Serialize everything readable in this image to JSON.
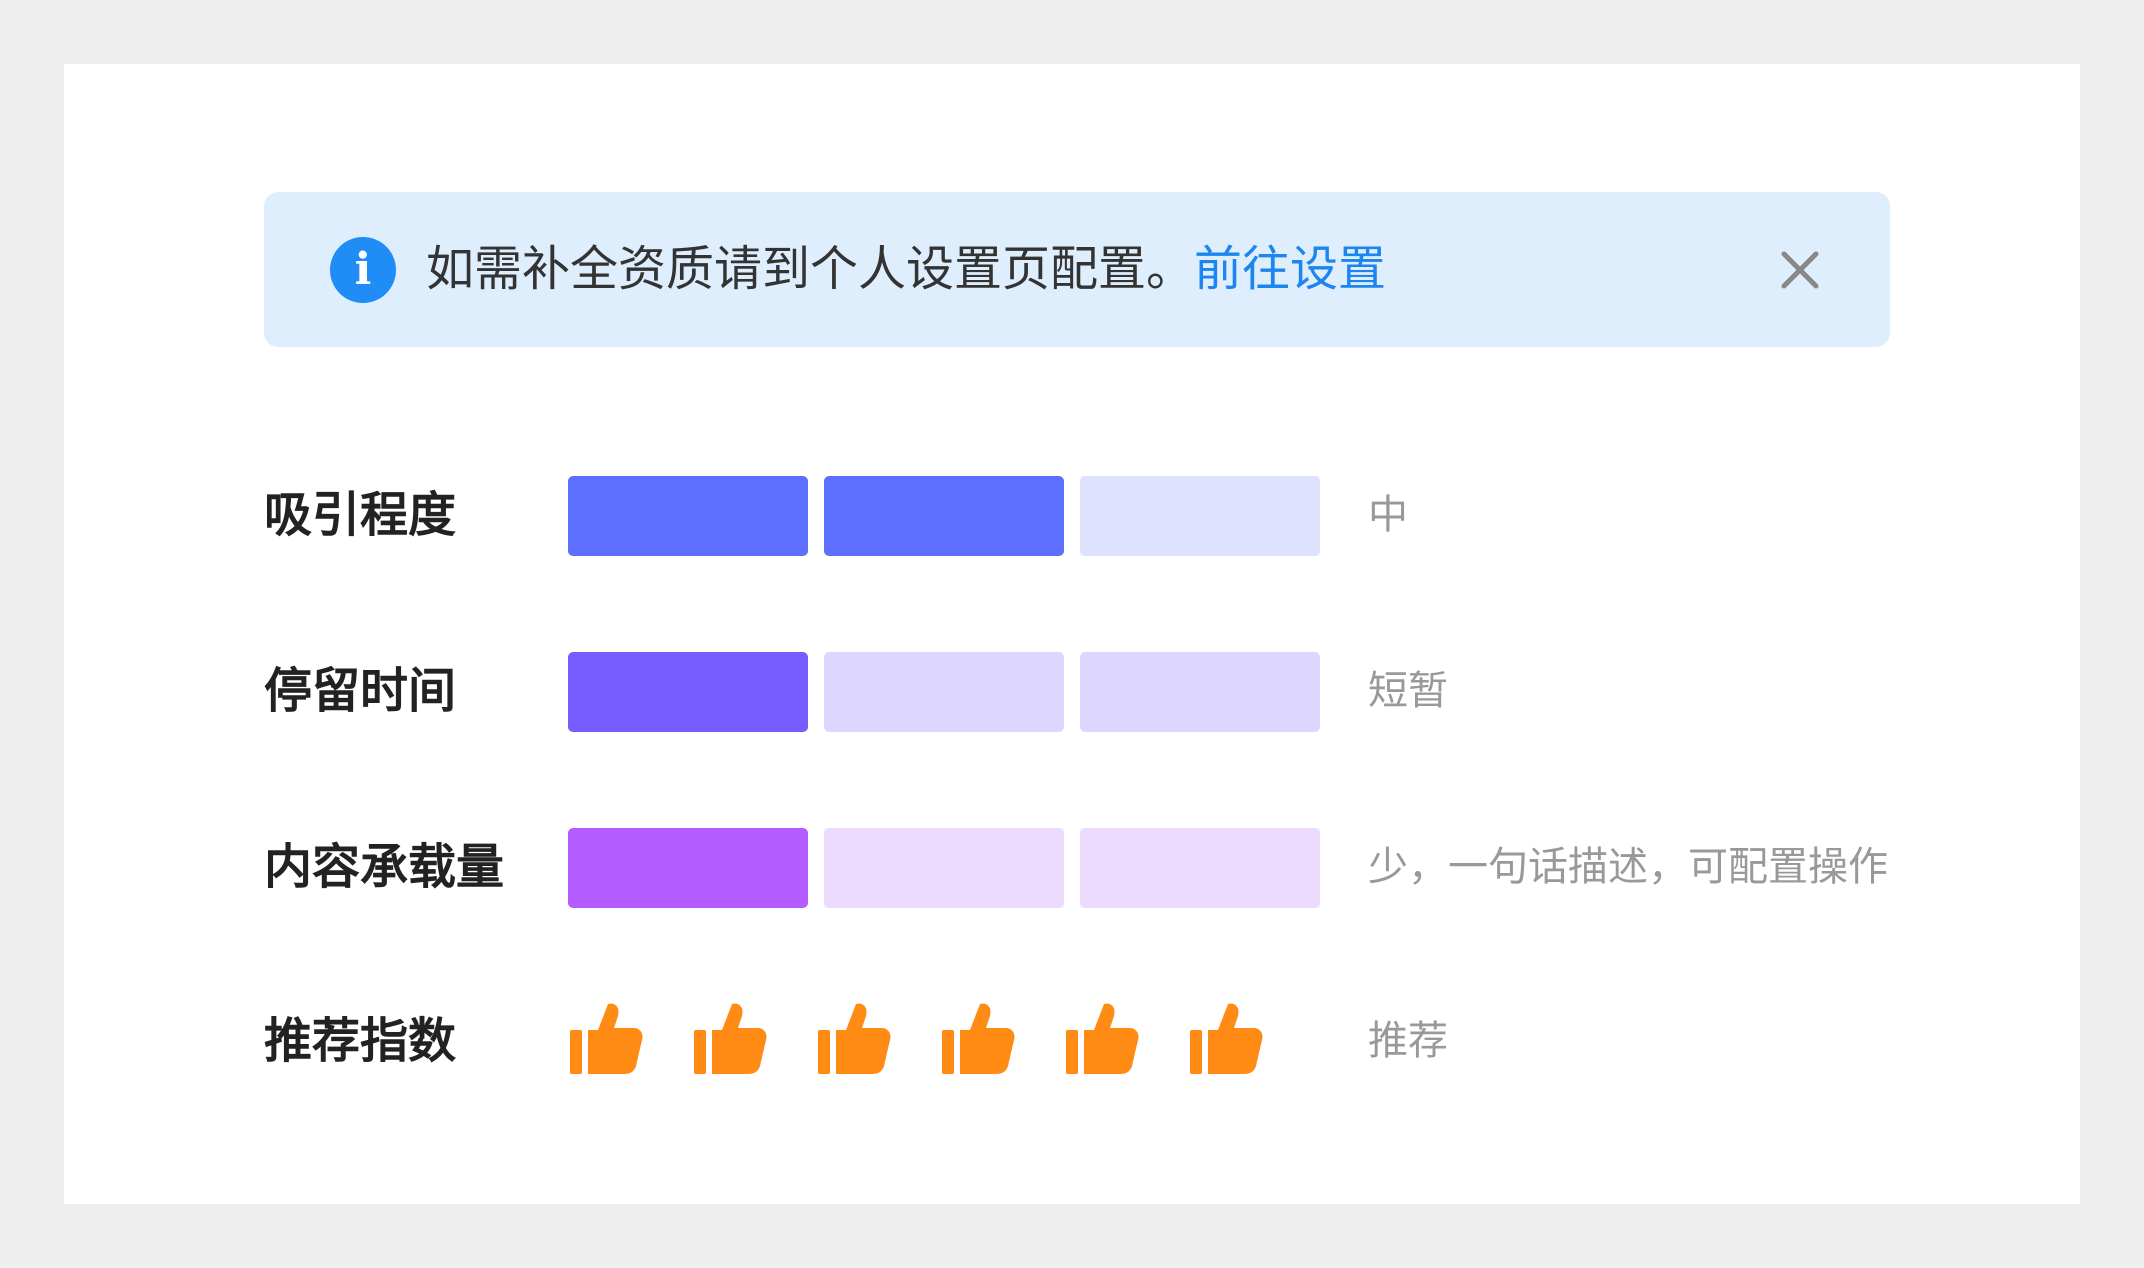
{
  "alert": {
    "icon": "info-icon",
    "message": "如需补全资质请到个人设置页配置。",
    "link_label": "前往设置",
    "close_icon": "close-icon",
    "background_color": "#dfeefd",
    "icon_color": "#1f8df5",
    "link_color": "#1d85ef"
  },
  "metrics": [
    {
      "label": "吸引程度",
      "value_text": "中",
      "level": 2,
      "max": 3,
      "active_color": "#5c6fff",
      "inactive_color": "#dee1fd"
    },
    {
      "label": "停留时间",
      "value_text": "短暂",
      "level": 1,
      "max": 3,
      "active_color": "#775cff",
      "inactive_color": "#ddd7ff"
    },
    {
      "label": "内容承载量",
      "value_text": "少，一句话描述，可配置操作",
      "level": 1,
      "max": 3,
      "active_color": "#b35cff",
      "inactive_color": "#ecdaff"
    }
  ],
  "recommend": {
    "label": "推荐指数",
    "value_text": "推荐",
    "icon": "thumbs-up-icon",
    "count": 6,
    "color": "#ff8a14"
  }
}
